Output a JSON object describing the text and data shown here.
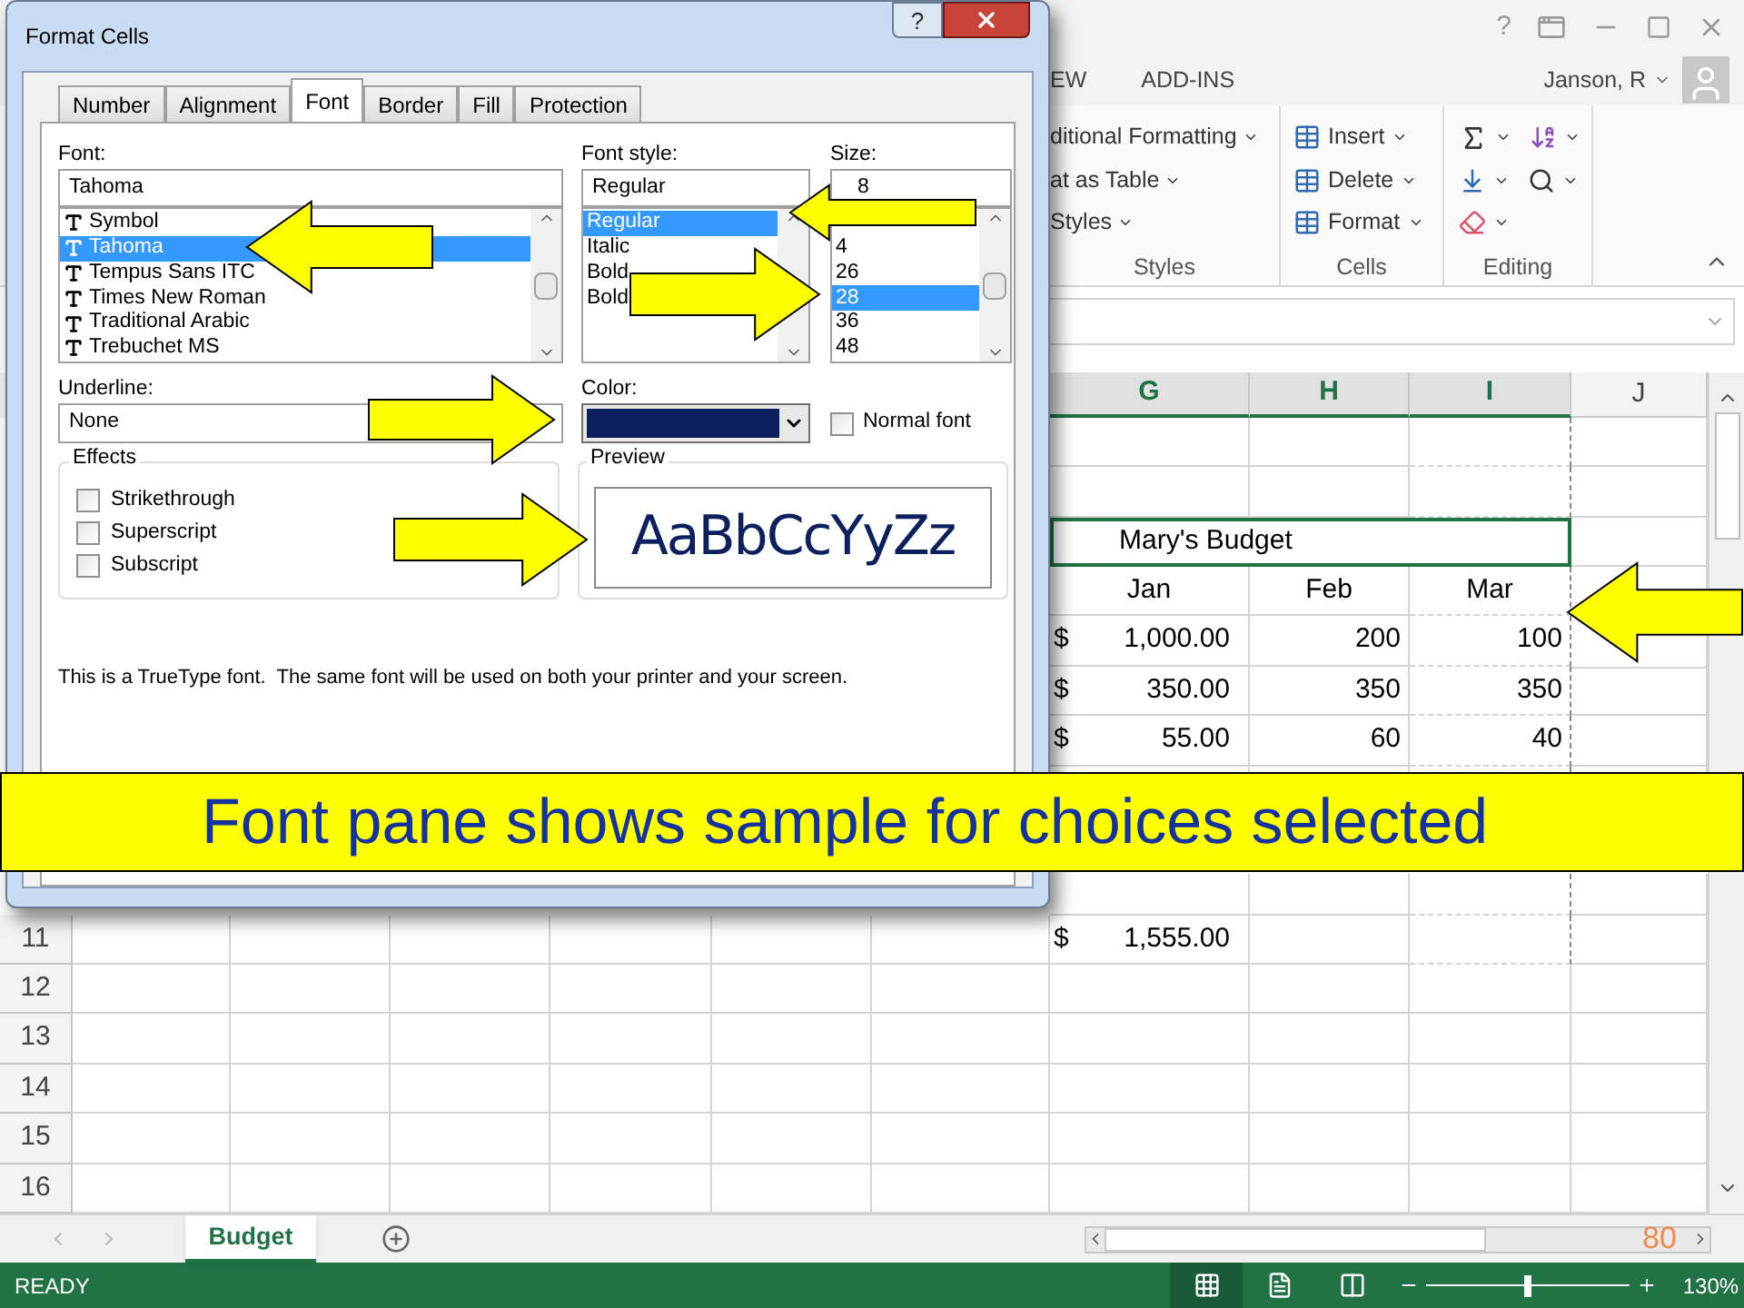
{
  "excel": {
    "help": "?",
    "ribbon_tabs": [
      "EW",
      "ADD-INS"
    ],
    "user": "Janson, R",
    "styles_group": {
      "items": [
        "ditional Formatting",
        "at as Table",
        "Styles"
      ],
      "label": "Styles"
    },
    "cells_group": {
      "items": [
        "Insert",
        "Delete",
        "Format"
      ],
      "label": "Cells"
    },
    "editing_group": {
      "label": "Editing"
    }
  },
  "sheet": {
    "columns": [
      {
        "label": "G",
        "selected": true
      },
      {
        "label": "H",
        "selected": true
      },
      {
        "label": "I",
        "selected": true
      },
      {
        "label": "J",
        "selected": false
      }
    ],
    "title_cell": {
      "text": "Mary's Budget",
      "selected": true
    },
    "months": [
      "Jan",
      "Feb",
      "Mar"
    ],
    "data_rows": [
      {
        "currency": "$",
        "amount": "1,000.00",
        "values": [
          "200",
          "100"
        ]
      },
      {
        "currency": "$",
        "amount": "350.00",
        "values": [
          "350",
          "350"
        ]
      },
      {
        "currency": "$",
        "amount": "55.00",
        "values": [
          "60",
          "40"
        ]
      }
    ],
    "total": {
      "currency": "$",
      "amount": "1,555.00"
    },
    "row_numbers": [
      "11",
      "12",
      "13",
      "14",
      "15",
      "16"
    ]
  },
  "sheet_tabs": [
    {
      "label": "Budget",
      "selected": true
    }
  ],
  "status": {
    "text": "READY",
    "views": [
      {
        "kind": "normal",
        "selected": true
      },
      {
        "kind": "page_layout",
        "selected": false
      },
      {
        "kind": "page_break",
        "selected": false
      }
    ],
    "zoom": {
      "level": 0.48,
      "reading": "130%"
    }
  },
  "slide_number": "80",
  "dialog": {
    "title": "Format Cells",
    "help": "?",
    "tabs": [
      {
        "label": "Number",
        "selected": false
      },
      {
        "label": "Alignment",
        "selected": false
      },
      {
        "label": "Font",
        "selected": true
      },
      {
        "label": "Border",
        "selected": false
      },
      {
        "label": "Fill",
        "selected": false
      },
      {
        "label": "Protection",
        "selected": false
      }
    ],
    "font": {
      "label": "Font:",
      "value": "Tahoma",
      "items": [
        {
          "label": "Symbol",
          "selected": false
        },
        {
          "label": "Tahoma",
          "selected": true
        },
        {
          "label": "Tempus Sans ITC",
          "selected": false
        },
        {
          "label": "Times New Roman",
          "selected": false
        },
        {
          "label": "Traditional Arabic",
          "selected": false
        },
        {
          "label": "Trebuchet MS",
          "selected": false
        }
      ]
    },
    "font_style": {
      "label": "Font style:",
      "value": "Regular",
      "items": [
        {
          "label": "Regular",
          "selected": true
        },
        {
          "label": "Italic",
          "selected": false
        },
        {
          "label": "Bold",
          "selected": false
        },
        {
          "label": "Bold",
          "selected": false
        }
      ]
    },
    "size": {
      "label": "Size:",
      "value": "8",
      "items": [
        {
          "label": "4",
          "selected": false
        },
        {
          "label": "26",
          "selected": false
        },
        {
          "label": "28",
          "selected": true
        },
        {
          "label": "36",
          "selected": false
        },
        {
          "label": "48",
          "selected": false
        }
      ]
    },
    "underline": {
      "label": "Underline:",
      "value": "None"
    },
    "color": {
      "label": "Color:",
      "color": "#0c1f5e"
    },
    "normal_font": {
      "label": "Normal font",
      "checked": false
    },
    "effects": {
      "title": "Effects",
      "options": [
        {
          "label": "Strikethrough",
          "checked": false
        },
        {
          "label": "Superscript",
          "checked": false
        },
        {
          "label": "Subscript",
          "checked": false
        }
      ]
    },
    "preview": {
      "title": "Preview",
      "sample": "AaBbCcYyZz"
    },
    "note": "This is a TrueType font.  The same font will be used on both your printer and your screen."
  },
  "callout": "Font pane shows sample for choices selected"
}
